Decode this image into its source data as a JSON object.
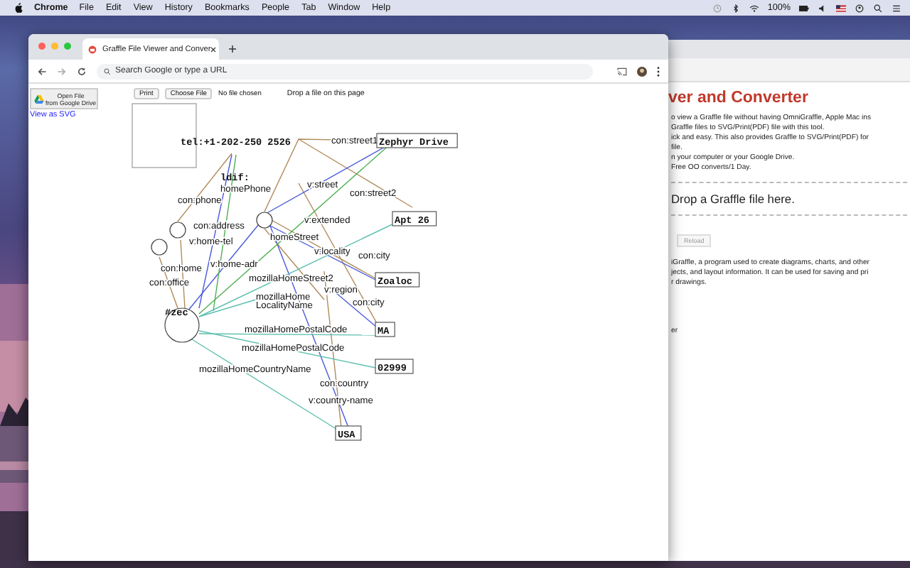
{
  "menubar": {
    "app": "Chrome",
    "menus": [
      "File",
      "Edit",
      "View",
      "History",
      "Bookmarks",
      "People",
      "Tab",
      "Window",
      "Help"
    ],
    "battery": "100%"
  },
  "browser": {
    "tab": {
      "title": "Graffle File Viewer and Conver"
    },
    "address": {
      "placeholder": "Search Google or type a URL"
    }
  },
  "page": {
    "drive_button": {
      "lines": [
        "Open File",
        "from Google Drive"
      ]
    },
    "svg_link": "View as SVG",
    "print_button": "Print",
    "file_button": "Choose File",
    "file_status": "No file chosen",
    "drop_hint": "Drop a file on this page",
    "diagram": {
      "nodes": [
        {
          "kind": "code",
          "text": "tel:+1-202-250 2526"
        },
        {
          "kind": "label",
          "text": "con:street1"
        },
        {
          "kind": "box",
          "text": "Zephyr Drive"
        },
        {
          "kind": "code",
          "text": "ldif:"
        },
        {
          "kind": "label",
          "text": "homePhone"
        },
        {
          "kind": "label",
          "text": "v:street"
        },
        {
          "kind": "label",
          "text": "con:street2"
        },
        {
          "kind": "label",
          "text": "con:phone"
        },
        {
          "kind": "label",
          "text": "v:extended"
        },
        {
          "kind": "box",
          "text": "Apt 26"
        },
        {
          "kind": "label",
          "text": "con:address"
        },
        {
          "kind": "label",
          "text": "homeStreet"
        },
        {
          "kind": "label",
          "text": "v:home-tel"
        },
        {
          "kind": "label",
          "text": "v:locality"
        },
        {
          "kind": "label",
          "text": "con:city"
        },
        {
          "kind": "label",
          "text": "con:home"
        },
        {
          "kind": "label",
          "text": "v:home-adr"
        },
        {
          "kind": "label",
          "text": "con:office"
        },
        {
          "kind": "label",
          "text": "mozillaHomeStreet2"
        },
        {
          "kind": "box",
          "text": "Zoaloc"
        },
        {
          "kind": "label",
          "text": "v:region"
        },
        {
          "kind": "code",
          "text": "#zec"
        },
        {
          "kind": "label",
          "text": "mozillaHome"
        },
        {
          "kind": "label",
          "text": "LocalityName"
        },
        {
          "kind": "label",
          "text": "con:city"
        },
        {
          "kind": "box",
          "text": "MA"
        },
        {
          "kind": "label",
          "text": "mozillaHomePostalCode"
        },
        {
          "kind": "label",
          "text": "mozillaHomePostalCode"
        },
        {
          "kind": "box",
          "text": "02999"
        },
        {
          "kind": "label",
          "text": "mozillaHomeCountryName"
        },
        {
          "kind": "label",
          "text": "con:country"
        },
        {
          "kind": "label",
          "text": "v:country-name"
        },
        {
          "kind": "box",
          "text": "USA"
        }
      ]
    }
  },
  "background_window": {
    "title": "ver and Converter",
    "intro": [
      "o view a Graffle file without having OmniGraffle, Apple Mac ins",
      "Graffle files to SVG/Print(PDF) file with this tool.",
      "ick and easy. This also provides Graffle to SVG/Print(PDF) for",
      "file.",
      "n your computer or your Google Drive.",
      "Free OO converts/1 Day."
    ],
    "drop_text": "Drop a Graffle file here.",
    "reload_button": "Reload",
    "about": [
      "iGraffle, a program used to create diagrams, charts, and other",
      "jects, and layout information. It can be used for saving and pri",
      "r drawings."
    ],
    "footer": "er"
  }
}
